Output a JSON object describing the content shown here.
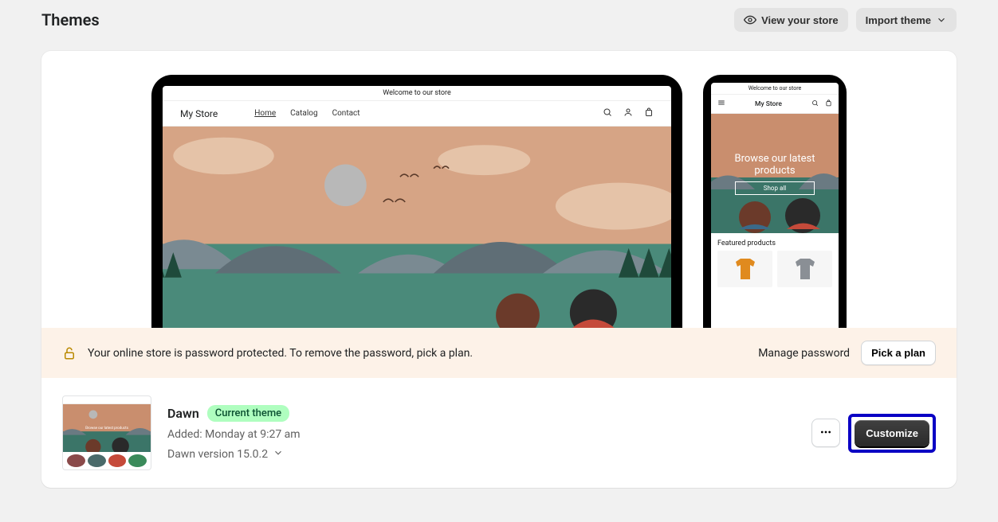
{
  "header": {
    "title": "Themes",
    "view_store_label": "View your store",
    "import_theme_label": "Import theme"
  },
  "preview": {
    "announcement": "Welcome to our store",
    "store_name": "My Store",
    "nav": {
      "home": "Home",
      "catalog": "Catalog",
      "contact": "Contact"
    },
    "phone": {
      "hero_line1": "Browse our latest",
      "hero_line2": "products",
      "shop_all": "Shop all",
      "featured_label": "Featured products"
    },
    "thumb_hero": "Browse our latest products"
  },
  "password_banner": {
    "message": "Your online store is password protected. To remove the password, pick a plan.",
    "manage_label": "Manage password",
    "pick_plan_label": "Pick a plan"
  },
  "theme": {
    "name": "Dawn",
    "badge": "Current theme",
    "added": "Added: Monday at 9:27 am",
    "version": "Dawn version 15.0.2",
    "customize_label": "Customize"
  }
}
